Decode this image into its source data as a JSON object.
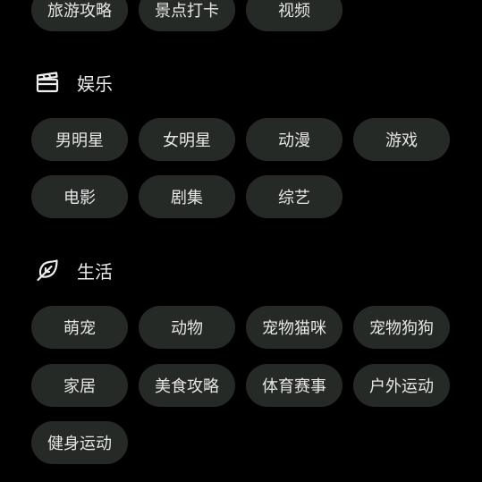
{
  "top_row": [
    "旅游攻略",
    "景点打卡",
    "视频"
  ],
  "sections": [
    {
      "icon": "clapperboard-icon",
      "title": "娱乐",
      "rows": [
        [
          "男明星",
          "女明星",
          "动漫",
          "游戏"
        ],
        [
          "电影",
          "剧集",
          "综艺"
        ]
      ]
    },
    {
      "icon": "leaf-icon",
      "title": "生活",
      "rows": [
        [
          "萌宠",
          "动物",
          "宠物猫咪",
          "宠物狗狗"
        ],
        [
          "家居",
          "美食攻略",
          "体育赛事",
          "户外运动"
        ],
        [
          "健身运动"
        ]
      ]
    }
  ],
  "colors": {
    "background": "#000000",
    "chip": "#262a27",
    "text": "#e6e6e6"
  }
}
